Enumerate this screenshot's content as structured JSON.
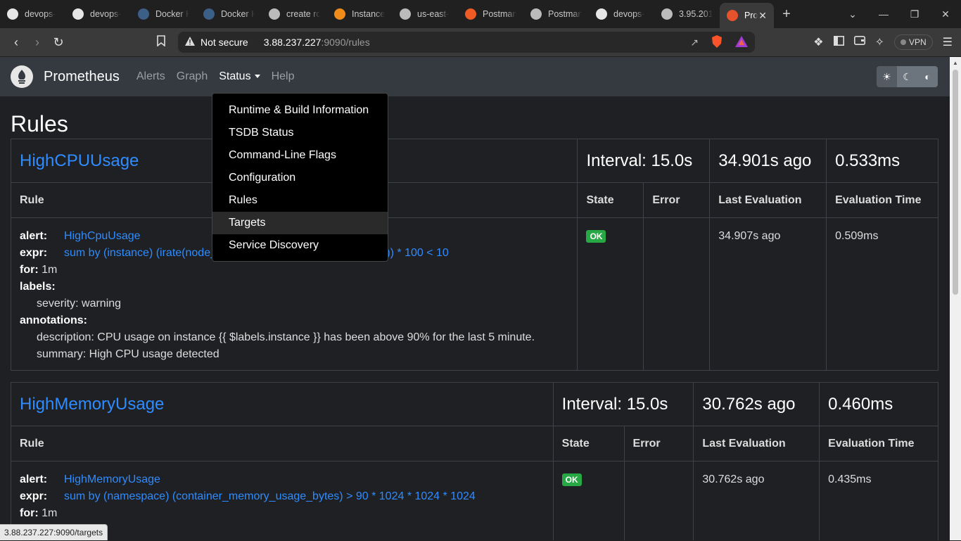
{
  "browser": {
    "tabs": [
      {
        "label": "devops-",
        "icon": "github-icon",
        "color": "#e6e6e6"
      },
      {
        "label": "devops-",
        "icon": "github-icon",
        "color": "#e6e6e6"
      },
      {
        "label": "Docker H",
        "icon": "docker-icon",
        "color": "#3b5f86"
      },
      {
        "label": "Docker H",
        "icon": "docker-icon",
        "color": "#3b5f86"
      },
      {
        "label": "create rc",
        "icon": "globe-icon",
        "color": "#bbbbbb"
      },
      {
        "label": "Instance",
        "icon": "aws-icon",
        "color": "#f08c1a"
      },
      {
        "label": "us-east-",
        "icon": "globe-icon",
        "color": "#bbbbbb"
      },
      {
        "label": "Postman",
        "icon": "postman-icon",
        "color": "#ef5b25"
      },
      {
        "label": "Postman",
        "icon": "globe-icon",
        "color": "#bbbbbb"
      },
      {
        "label": "devops-",
        "icon": "github-icon",
        "color": "#e6e6e6"
      },
      {
        "label": "3.95.201",
        "icon": "globe-icon",
        "color": "#bbbbbb"
      },
      {
        "label": "Pro",
        "icon": "prometheus-icon",
        "color": "#e6522c",
        "active": true
      }
    ],
    "security_label": "Not secure",
    "url_host": "3.88.237.227",
    "url_path": ":9090/rules",
    "vpn_label": "VPN",
    "status_url": "3.88.237.227:9090/targets"
  },
  "app": {
    "brand": "Prometheus",
    "nav": {
      "alerts": "Alerts",
      "graph": "Graph",
      "status": "Status",
      "help": "Help"
    },
    "page_title": "Rules",
    "status_menu": [
      "Runtime & Build Information",
      "TSDB Status",
      "Command-Line Flags",
      "Configuration",
      "Rules",
      "Targets",
      "Service Discovery"
    ]
  },
  "groups": [
    {
      "name": "HighCPUUsage",
      "interval": "Interval: 15.0s",
      "last_eval": "34.901s ago",
      "eval_time": "0.533ms",
      "columns": {
        "rule": "Rule",
        "state": "State",
        "error": "Error",
        "last_evaluation": "Last Evaluation",
        "evaluation_time": "Evaluation Time"
      },
      "rule": {
        "alert_key": "alert:",
        "alert": "HighCpuUsage",
        "expr_key": "expr:",
        "expr_a": "sum by (instance) (irate(node_",
        "expr_b": "n])) * 100 < 10",
        "for_key": "for:",
        "for": "1m",
        "labels_key": "labels:",
        "severity": "severity: warning",
        "annotations_key": "annotations:",
        "description": "description: CPU usage on instance {{ $labels.instance }} has been above 90% for the last 5 minute.",
        "summary": "summary: High CPU usage detected",
        "state": "OK",
        "last_eval": "34.907s ago",
        "eval_time": "0.509ms"
      }
    },
    {
      "name": "HighMemoryUsage",
      "interval": "Interval: 15.0s",
      "last_eval": "30.762s ago",
      "eval_time": "0.460ms",
      "columns": {
        "rule": "Rule",
        "state": "State",
        "error": "Error",
        "last_evaluation": "Last Evaluation",
        "evaluation_time": "Evaluation Time"
      },
      "rule": {
        "alert_key": "alert:",
        "alert": "HighMemoryUsage",
        "expr_key": "expr:",
        "expr": "sum by (namespace) (container_memory_usage_bytes) > 90 * 1024 * 1024 * 1024",
        "for_key": "for:",
        "for": "1m",
        "state": "OK",
        "last_eval": "30.762s ago",
        "eval_time": "0.435ms"
      }
    }
  ]
}
